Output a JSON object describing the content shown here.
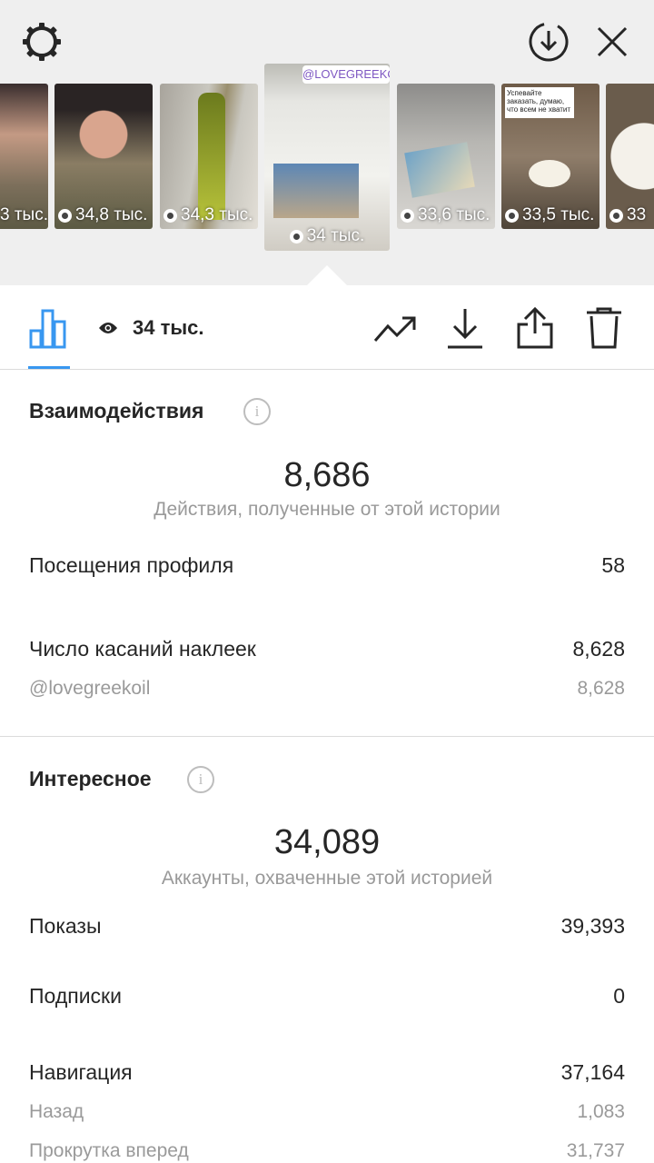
{
  "header": {
    "settings_icon": "settings-gear-icon",
    "download_icon": "download-circle-icon",
    "close_icon": "close-icon"
  },
  "stories": [
    {
      "views": "3 тыс."
    },
    {
      "views": "34,8 тыс."
    },
    {
      "views": "34,3 тыс."
    },
    {
      "views": "34 тыс.",
      "selected": true,
      "sticker": "@LOVEGREEKOIL"
    },
    {
      "views": "33,6 тыс."
    },
    {
      "views": "33,5 тыс.",
      "caption": "Успевайте заказать, думаю, что всем не хватит"
    },
    {
      "views": "33"
    }
  ],
  "toolbar": {
    "views": "34 тыс."
  },
  "interactions": {
    "title": "Взаимодействия",
    "total": "8,686",
    "total_label": "Действия, полученные от этой истории",
    "profile_visits_label": "Посещения профиля",
    "profile_visits_value": "58",
    "sticker_taps_label": "Число касаний наклеек",
    "sticker_taps_value": "8,628",
    "sticker_name": "@lovegreekoil",
    "sticker_name_value": "8,628"
  },
  "discovery": {
    "title": "Интересное",
    "total": "34,089",
    "total_label": "Аккаунты, охваченные этой историей",
    "impressions_label": "Показы",
    "impressions_value": "39,393",
    "follows_label": "Подписки",
    "follows_value": "0",
    "navigation_label": "Навигация",
    "navigation_value": "37,164",
    "back_label": "Назад",
    "back_value": "1,083",
    "forward_label": "Прокрутка вперед",
    "forward_value": "31,737"
  },
  "colors": {
    "accent": "#3897f0",
    "muted": "#999999",
    "text": "#262626"
  }
}
